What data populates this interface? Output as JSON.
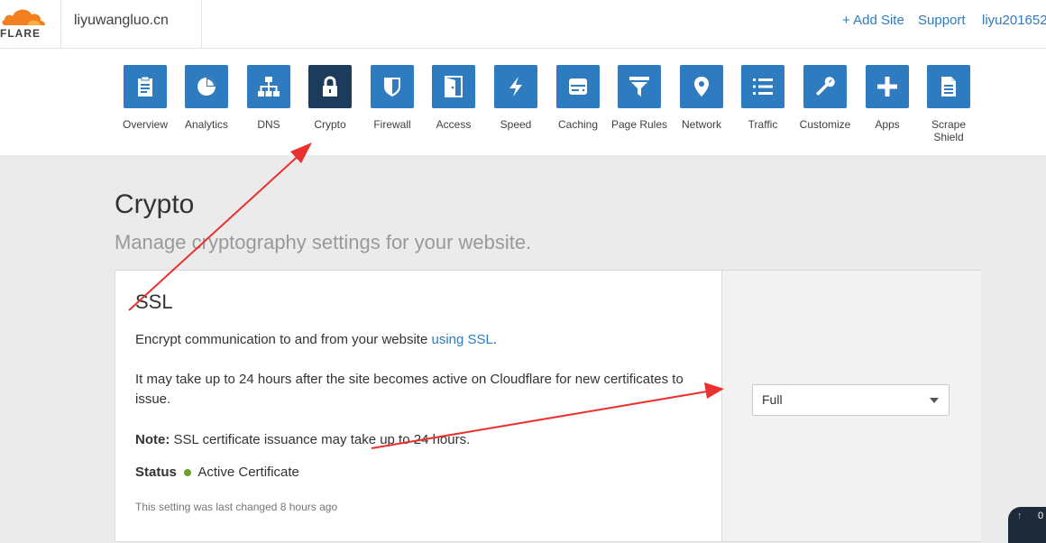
{
  "header": {
    "logo_text": "FLARE",
    "domain": "liyuwangluo.cn",
    "add_site": "+ Add Site",
    "support": "Support",
    "user": "liyu201652"
  },
  "nav": {
    "items": [
      {
        "label": "Overview",
        "icon": "clipboard-icon"
      },
      {
        "label": "Analytics",
        "icon": "pie-chart-icon"
      },
      {
        "label": "DNS",
        "icon": "sitemap-icon"
      },
      {
        "label": "Crypto",
        "icon": "lock-icon",
        "active": true
      },
      {
        "label": "Firewall",
        "icon": "shield-icon"
      },
      {
        "label": "Access",
        "icon": "door-icon"
      },
      {
        "label": "Speed",
        "icon": "lightning-icon"
      },
      {
        "label": "Caching",
        "icon": "hard-drive-icon"
      },
      {
        "label": "Page Rules",
        "icon": "filter-icon"
      },
      {
        "label": "Network",
        "icon": "map-pin-icon"
      },
      {
        "label": "Traffic",
        "icon": "list-icon"
      },
      {
        "label": "Customize",
        "icon": "wrench-icon"
      },
      {
        "label": "Apps",
        "icon": "plus-icon"
      },
      {
        "label": "Scrape Shield",
        "icon": "document-icon"
      }
    ]
  },
  "page": {
    "title": "Crypto",
    "subtitle": "Manage cryptography settings for your website."
  },
  "ssl": {
    "title": "SSL",
    "desc_prefix": "Encrypt communication to and from your website ",
    "desc_link": "using SSL",
    "desc_suffix": ".",
    "wait_text": "It may take up to 24 hours after the site becomes active on Cloudflare for new certificates to issue.",
    "note_label": "Note:",
    "note_text": " SSL certificate issuance may take up to 24 hours.",
    "status_label": "Status",
    "status_value": "Active Certificate",
    "last_changed": "This setting was last changed 8 hours ago",
    "mode": "Full"
  },
  "colors": {
    "accent": "#2f7bbf",
    "active_nav": "#1d3b5c",
    "status_ok": "#6ea12b",
    "logo_orange": "#f38020",
    "annotation_red": "#e8322f"
  },
  "scroll_widget": {
    "text": "0"
  }
}
